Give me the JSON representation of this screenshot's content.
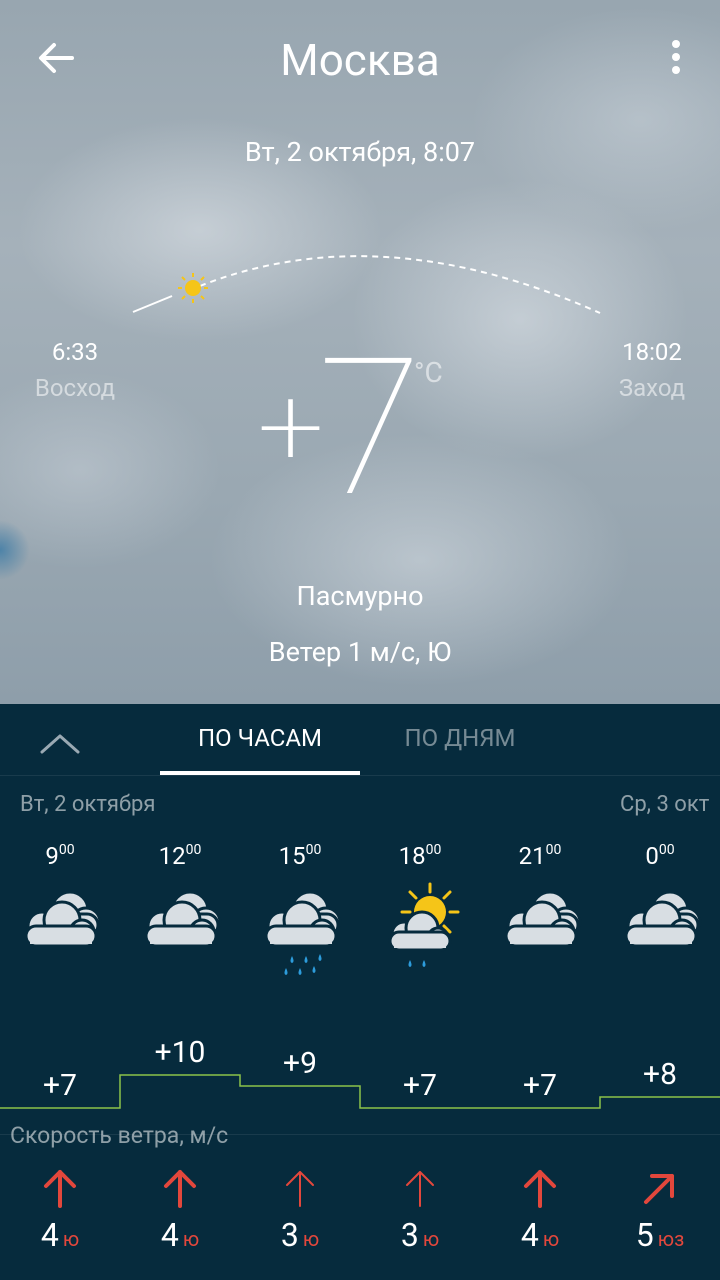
{
  "header": {
    "city": "Москва",
    "datetime": "Вт, 2 октября, 8:07"
  },
  "sun": {
    "sunrise_time": "6:33",
    "sunrise_label": "Восход",
    "sunset_time": "18:02",
    "sunset_label": "Заход"
  },
  "current": {
    "temp_sign": "+",
    "temp_value": "7",
    "unit": "°C",
    "condition": "Пасмурно",
    "wind": "Ветер 1 м/с, Ю"
  },
  "tabs": {
    "hours": "ПО ЧАСАМ",
    "days": "ПО ДНЯМ",
    "active": "hours"
  },
  "days": {
    "first": "Вт, 2 октября",
    "second": "Ср, 3 окт"
  },
  "hourly": [
    {
      "hour": "9",
      "minutes": "00",
      "icon": "cloudy-icon",
      "temp": "+7",
      "temp_value": 7,
      "wind_speed": "4",
      "wind_dir": "ю",
      "wind_arrow": "arrow-up-icon"
    },
    {
      "hour": "12",
      "minutes": "00",
      "icon": "cloudy-icon",
      "temp": "+10",
      "temp_value": 10,
      "wind_speed": "4",
      "wind_dir": "ю",
      "wind_arrow": "arrow-up-icon"
    },
    {
      "hour": "15",
      "minutes": "00",
      "icon": "cloudy-rain-icon",
      "temp": "+9",
      "temp_value": 9,
      "wind_speed": "3",
      "wind_dir": "ю",
      "wind_arrow": "arrow-up-thin-icon"
    },
    {
      "hour": "18",
      "minutes": "00",
      "icon": "sun-cloud-rain-icon",
      "temp": "+7",
      "temp_value": 7,
      "wind_speed": "3",
      "wind_dir": "ю",
      "wind_arrow": "arrow-up-thin-icon"
    },
    {
      "hour": "21",
      "minutes": "00",
      "icon": "cloudy-icon",
      "temp": "+7",
      "temp_value": 7,
      "wind_speed": "4",
      "wind_dir": "ю",
      "wind_arrow": "arrow-up-icon"
    },
    {
      "hour": "0",
      "minutes": "00",
      "icon": "cloudy-icon",
      "temp": "+8",
      "temp_value": 8,
      "wind_speed": "5",
      "wind_dir": "юз",
      "wind_arrow": "arrow-up-right-icon"
    }
  ],
  "wind_section_title": "Скорость ветра, м/с",
  "colors": {
    "panel_bg": "#062b3d",
    "wind_arrow": "#e2473c",
    "temp_line": "#8bc34a",
    "rain_drop": "#2d9cdb",
    "sun": "#f5c518"
  }
}
